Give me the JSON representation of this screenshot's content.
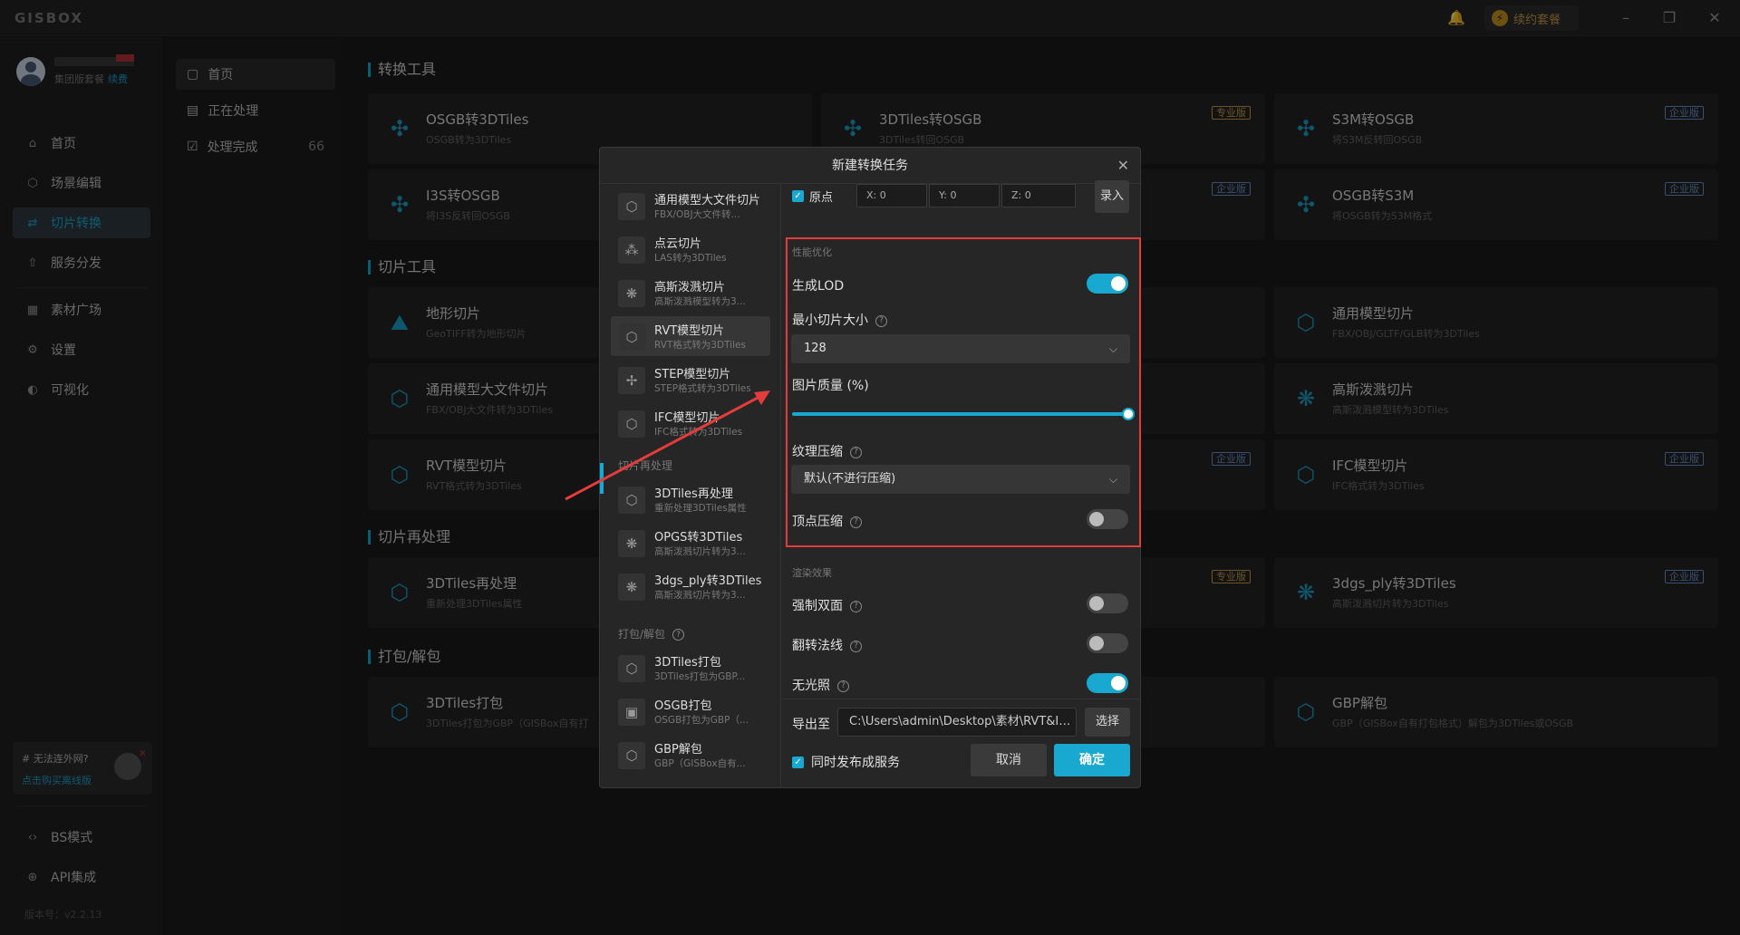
{
  "app": {
    "logo": "GISBOX",
    "renew": "续约套餐"
  },
  "user": {
    "plan": "集团版套餐",
    "renew_link": "续费"
  },
  "sidebar": {
    "items": [
      {
        "label": "首页",
        "icon": "home-icon"
      },
      {
        "label": "场景编辑",
        "icon": "cube-icon"
      },
      {
        "label": "切片转换",
        "icon": "convert-icon"
      },
      {
        "label": "服务分发",
        "icon": "upload-icon"
      },
      {
        "label": "素材广场",
        "icon": "chart-icon"
      },
      {
        "label": "设置",
        "icon": "gear-icon"
      },
      {
        "label": "可视化",
        "icon": "visual-icon"
      }
    ],
    "promo": {
      "title": "# 无法连外网?",
      "link": "点击购买离线版"
    },
    "bottom": [
      {
        "label": "BS模式",
        "icon": "code-icon"
      },
      {
        "label": "API集成",
        "icon": "api-icon"
      }
    ],
    "version": "版本号：v2.2.13"
  },
  "subnav": {
    "items": [
      {
        "label": "首页"
      },
      {
        "label": "正在处理"
      },
      {
        "label": "处理完成",
        "count": "66"
      }
    ]
  },
  "main": {
    "sections": [
      "转换工具",
      "切片工具",
      "切片再处理",
      "打包/解包"
    ],
    "cards": [
      {
        "title": "OSGB转3DTiles",
        "sub": "OSGB转为3DTiles"
      },
      {
        "title": "3DTiles转OSGB",
        "sub": "3DTiles转回OSGB",
        "badge": "专业版"
      },
      {
        "title": "S3M转OSGB",
        "sub": "将S3M反转回OSGB",
        "badge": "企业版"
      },
      {
        "title": "I3S转OSGB",
        "sub": "将I3S反转回OSGB"
      },
      {
        "title": "",
        "sub": "",
        "badge": "企业版"
      },
      {
        "title": "OSGB转S3M",
        "sub": "将OSGB转为S3M格式",
        "badge": "企业版"
      },
      {
        "title": "地形切片",
        "sub": "GeoTIFF转为地形切片"
      },
      {
        "title": "通用模型切片",
        "sub": "FBX/OBJ/GLTF/GLB转为3DTiles"
      },
      {
        "title": "通用模型大文件切片",
        "sub": "FBX/OBJ大文件转为3DTiles"
      },
      {
        "title": "高斯泼溅切片",
        "sub": "高斯泼溅模型转为3DTiles"
      },
      {
        "title": "RVT模型切片",
        "sub": "RVT格式转为3DTiles"
      },
      {
        "title": "",
        "sub": "",
        "badge": "企业版"
      },
      {
        "title": "IFC模型切片",
        "sub": "IFC格式转为3DTiles",
        "badge": "企业版"
      },
      {
        "title": "3DTiles再处理",
        "sub": "重新处理3DTiles属性"
      },
      {
        "title": "",
        "sub": "",
        "badge": "专业版"
      },
      {
        "title": "3dgs_ply转3DTiles",
        "sub": "高斯泼溅切片转为3DTiles",
        "badge": "企业版"
      },
      {
        "title": "3DTiles打包",
        "sub": "3DTiles打包为GBP（GISBox自有打"
      },
      {
        "title": "GBP解包",
        "sub": "GBP（GISBox自有打包格式）解包为3DTiles或OSGB"
      }
    ]
  },
  "modal": {
    "title": "新建转换任务",
    "list": [
      {
        "title": "通用模型大文件切片",
        "sub": "FBX/OBJ大文件转..."
      },
      {
        "title": "点云切片",
        "sub": "LAS转为3DTiles"
      },
      {
        "title": "高斯泼溅切片",
        "sub": "高斯泼溅模型转为3..."
      },
      {
        "title": "RVT模型切片",
        "sub": "RVT格式转为3DTiles"
      },
      {
        "title": "STEP模型切片",
        "sub": "STEP格式转为3DTiles"
      },
      {
        "title": "IFC模型切片",
        "sub": "IFC格式转为3DTiles"
      }
    ],
    "group2": "切片再处理",
    "list2": [
      {
        "title": "3DTiles再处理",
        "sub": "重新处理3DTiles属性"
      },
      {
        "title": "OPGS转3DTiles",
        "sub": "高斯泼溅切片转为3..."
      },
      {
        "title": "3dgs_ply转3DTiles",
        "sub": "高斯泼溅切片转为3..."
      }
    ],
    "group3": "打包/解包",
    "list3": [
      {
        "title": "3DTiles打包",
        "sub": "3DTiles打包为GBP..."
      },
      {
        "title": "OSGB打包",
        "sub": "OSGB打包为GBP（..."
      },
      {
        "title": "GBP解包",
        "sub": "GBP（GISBox自有..."
      }
    ],
    "origin": {
      "label": "原点",
      "x": "X: 0",
      "y": "Y: 0",
      "z": "Z: 0",
      "button": "录入"
    },
    "perf": {
      "group": "性能优化",
      "lod": {
        "label": "生成LOD",
        "on": true
      },
      "min_tile": {
        "label": "最小切片大小",
        "value": "128"
      },
      "quality": {
        "label": "图片质量 (%)",
        "value": 100
      },
      "texture": {
        "label": "纹理压缩",
        "value": "默认(不进行压缩)"
      },
      "vertex": {
        "label": "顶点压缩",
        "on": false
      }
    },
    "render": {
      "group": "渲染效果",
      "double": {
        "label": "强制双面",
        "on": false
      },
      "flip": {
        "label": "翻转法线",
        "on": false
      },
      "unlit": {
        "label": "无光照",
        "on": true
      }
    },
    "export": {
      "label": "导出至",
      "path": "C:\\Users\\admin\\Desktop\\素材\\RVT&IFC...",
      "button": "选择"
    },
    "publish": {
      "label": "同时发布成服务"
    },
    "cancel": "取消",
    "confirm": "确定"
  },
  "colors": {
    "accent": "#19a8cf",
    "highlight": "#e23c3c"
  }
}
